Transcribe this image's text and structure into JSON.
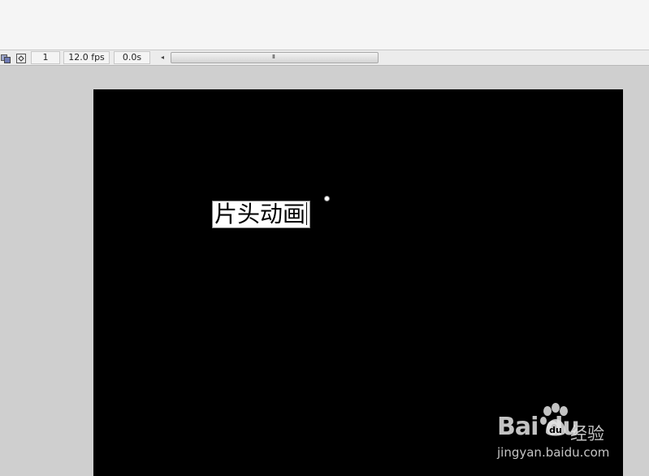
{
  "status_bar": {
    "edit_symbols_icon": "layers-icon",
    "fit_stage_icon": "fit-frame-icon",
    "current_frame": "1",
    "frame_rate": "12.0 fps",
    "elapsed_time": "0.0s",
    "scroll_left_arrow": "◂",
    "scroll_grip": "III"
  },
  "stage": {
    "background_color": "#000000",
    "text_field_value": "片头动画"
  },
  "watermark": {
    "logo_text": "Bai du",
    "name": "经验",
    "url": "jingyan.baidu.com"
  }
}
